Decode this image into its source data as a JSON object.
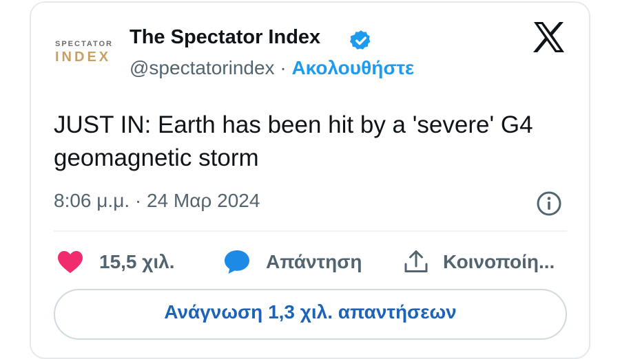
{
  "author": {
    "avatar_line1": "SPECTATOR",
    "avatar_line2": "INDEX",
    "name": "The Spectator Index",
    "handle": "@spectatorindex",
    "separator": " · ",
    "follow_label": "Ακολουθήστε"
  },
  "tweet": {
    "text": "JUST IN: Earth has been hit by a 'severe' G4 geomagnetic storm",
    "timestamp": "8:06 μ.μ. · 24 Μαρ 2024"
  },
  "actions": {
    "likes": "15,5 χιλ.",
    "reply_label": "Απάντηση",
    "share_label": "Κοινοποίη..."
  },
  "read_replies_label": "Ανάγνωση 1,3 χιλ. απαντήσεων",
  "colors": {
    "verified": "#1d9bf0",
    "follow": "#1d9bf0",
    "like": "#f02b6e",
    "reply_bubble": "#1d8ae6",
    "read_button_text": "#1d63b8"
  },
  "icons": {
    "verified": "verified-badge-icon",
    "platform": "x-logo-icon",
    "info": "info-icon",
    "like": "heart-icon",
    "reply": "speech-bubble-icon",
    "share": "share-upload-icon"
  }
}
